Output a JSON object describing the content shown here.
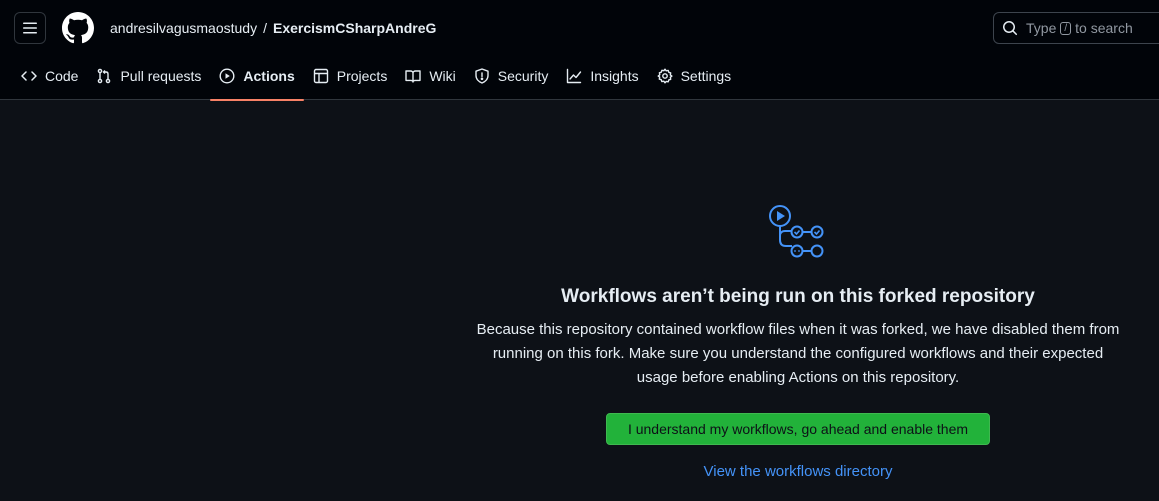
{
  "header": {
    "owner": "andresilvagusmaostudy",
    "separator": "/",
    "repo": "ExercismCSharpAndreG",
    "search_prefix": "Type",
    "search_key": "/",
    "search_suffix": "to search"
  },
  "tabs": [
    {
      "label": "Code",
      "icon": "code-icon"
    },
    {
      "label": "Pull requests",
      "icon": "git-pull-request-icon"
    },
    {
      "label": "Actions",
      "icon": "play-icon",
      "active": true
    },
    {
      "label": "Projects",
      "icon": "table-icon"
    },
    {
      "label": "Wiki",
      "icon": "book-icon"
    },
    {
      "label": "Security",
      "icon": "shield-icon"
    },
    {
      "label": "Insights",
      "icon": "graph-icon"
    },
    {
      "label": "Settings",
      "icon": "gear-icon"
    }
  ],
  "main": {
    "icon": "workflow-icon",
    "title": "Workflows aren’t being run on this forked repository",
    "description_line1": "Because this repository contained workflow files when it was forked, we have disabled them from",
    "description_line2": "running on this fork. Make sure you understand the configured workflows and their expected",
    "description_line3": "usage before enabling Actions on this repository.",
    "enable_button": "I understand my workflows, go ahead and enable them",
    "workflows_link": "View the workflows directory"
  },
  "colors": {
    "background": "#0d1117",
    "header_bg": "#010409",
    "active_tab_underline": "#f78166",
    "button_green": "#22b23a",
    "link_blue": "#4493f8",
    "icon_blue": "#4493f8"
  }
}
